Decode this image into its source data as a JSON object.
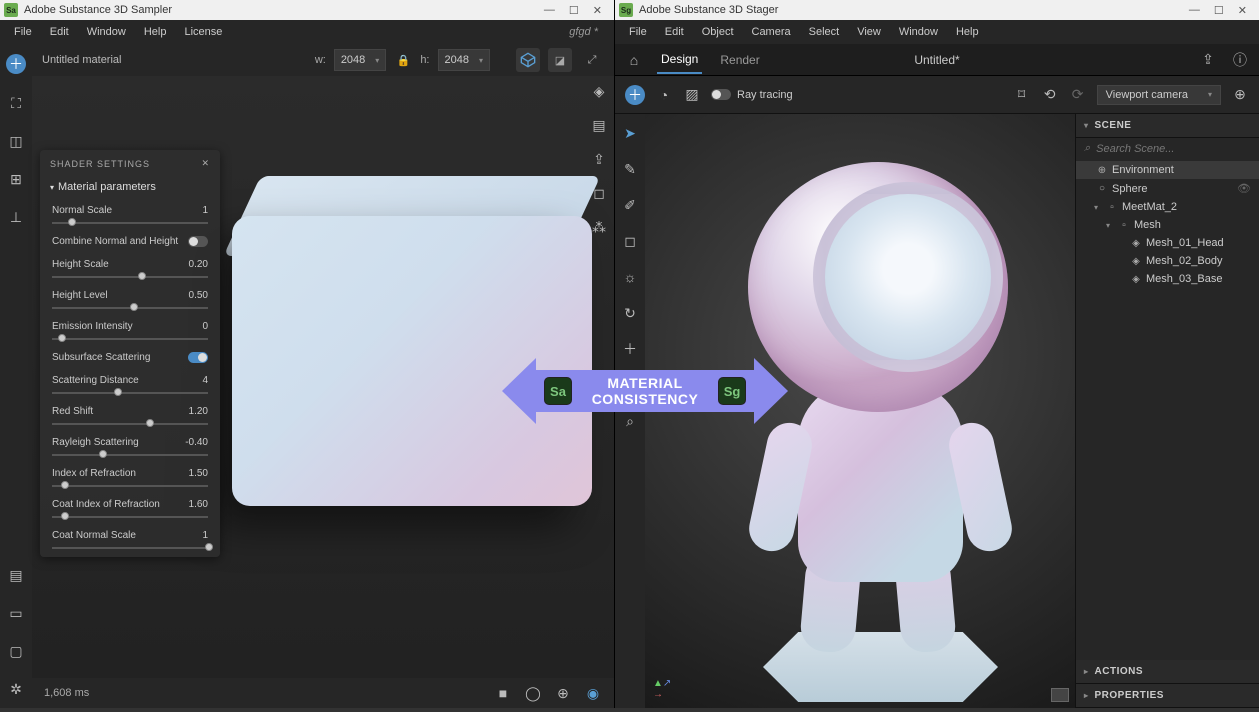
{
  "left": {
    "app_title": "Adobe Substance 3D Sampler",
    "logo": "Sa",
    "menu": [
      "File",
      "Edit",
      "Window",
      "Help",
      "License"
    ],
    "document": "gfgd *",
    "material_name": "Untitled material",
    "dim": {
      "w_label": "w:",
      "w_value": "2048",
      "h_label": "h:",
      "h_value": "2048"
    },
    "shader": {
      "title": "SHADER SETTINGS",
      "section": "Material parameters",
      "params": [
        {
          "label": "Normal Scale",
          "value": "1",
          "pos": 10
        },
        {
          "label": "Combine Normal and Height",
          "type": "toggle",
          "on": false
        },
        {
          "label": "Height Scale",
          "value": "0.20",
          "pos": 55
        },
        {
          "label": "Height Level",
          "value": "0.50",
          "pos": 50
        },
        {
          "label": "Emission Intensity",
          "value": "0",
          "pos": 4
        },
        {
          "label": "Subsurface Scattering",
          "type": "toggle",
          "on": true
        },
        {
          "label": "Scattering Distance",
          "value": "4",
          "pos": 40
        },
        {
          "label": "Red Shift",
          "value": "1.20",
          "pos": 60
        },
        {
          "label": "Rayleigh Scattering",
          "value": "-0.40",
          "pos": 30
        },
        {
          "label": "Index of Refraction",
          "value": "1.50",
          "pos": 6
        },
        {
          "label": "Coat Index of Refraction",
          "value": "1.60",
          "pos": 6
        },
        {
          "label": "Coat Normal Scale",
          "value": "1",
          "pos": 98
        }
      ]
    },
    "footer_ms": "1,608 ms"
  },
  "right": {
    "app_title": "Adobe Substance 3D Stager",
    "logo": "Sg",
    "menu": [
      "File",
      "Edit",
      "Object",
      "Camera",
      "Select",
      "View",
      "Window",
      "Help"
    ],
    "tabs": {
      "design": "Design",
      "render": "Render"
    },
    "document": "Untitled*",
    "ray_tracing": "Ray tracing",
    "camera": "Viewport camera",
    "scene": {
      "heading": "SCENE",
      "search_placeholder": "Search Scene...",
      "items": [
        {
          "label": "Environment",
          "icon": "⊕",
          "selected": true
        },
        {
          "label": "Sphere",
          "icon": "○",
          "eye": true
        },
        {
          "label": "MeetMat_2",
          "icon": "▫",
          "chv": true,
          "indent": 1
        },
        {
          "label": "Mesh",
          "icon": "▫",
          "chv": true,
          "indent": 2
        },
        {
          "label": "Mesh_01_Head",
          "icon": "◈",
          "indent": 3
        },
        {
          "label": "Mesh_02_Body",
          "icon": "◈",
          "indent": 3
        },
        {
          "label": "Mesh_03_Base",
          "icon": "◈",
          "indent": 3
        }
      ]
    },
    "actions": "ACTIONS",
    "properties": "PROPERTIES"
  },
  "overlay": {
    "line1": "MATERIAL",
    "line2": "CONSISTENCY",
    "badge_left": "Sa",
    "badge_right": "Sg"
  }
}
